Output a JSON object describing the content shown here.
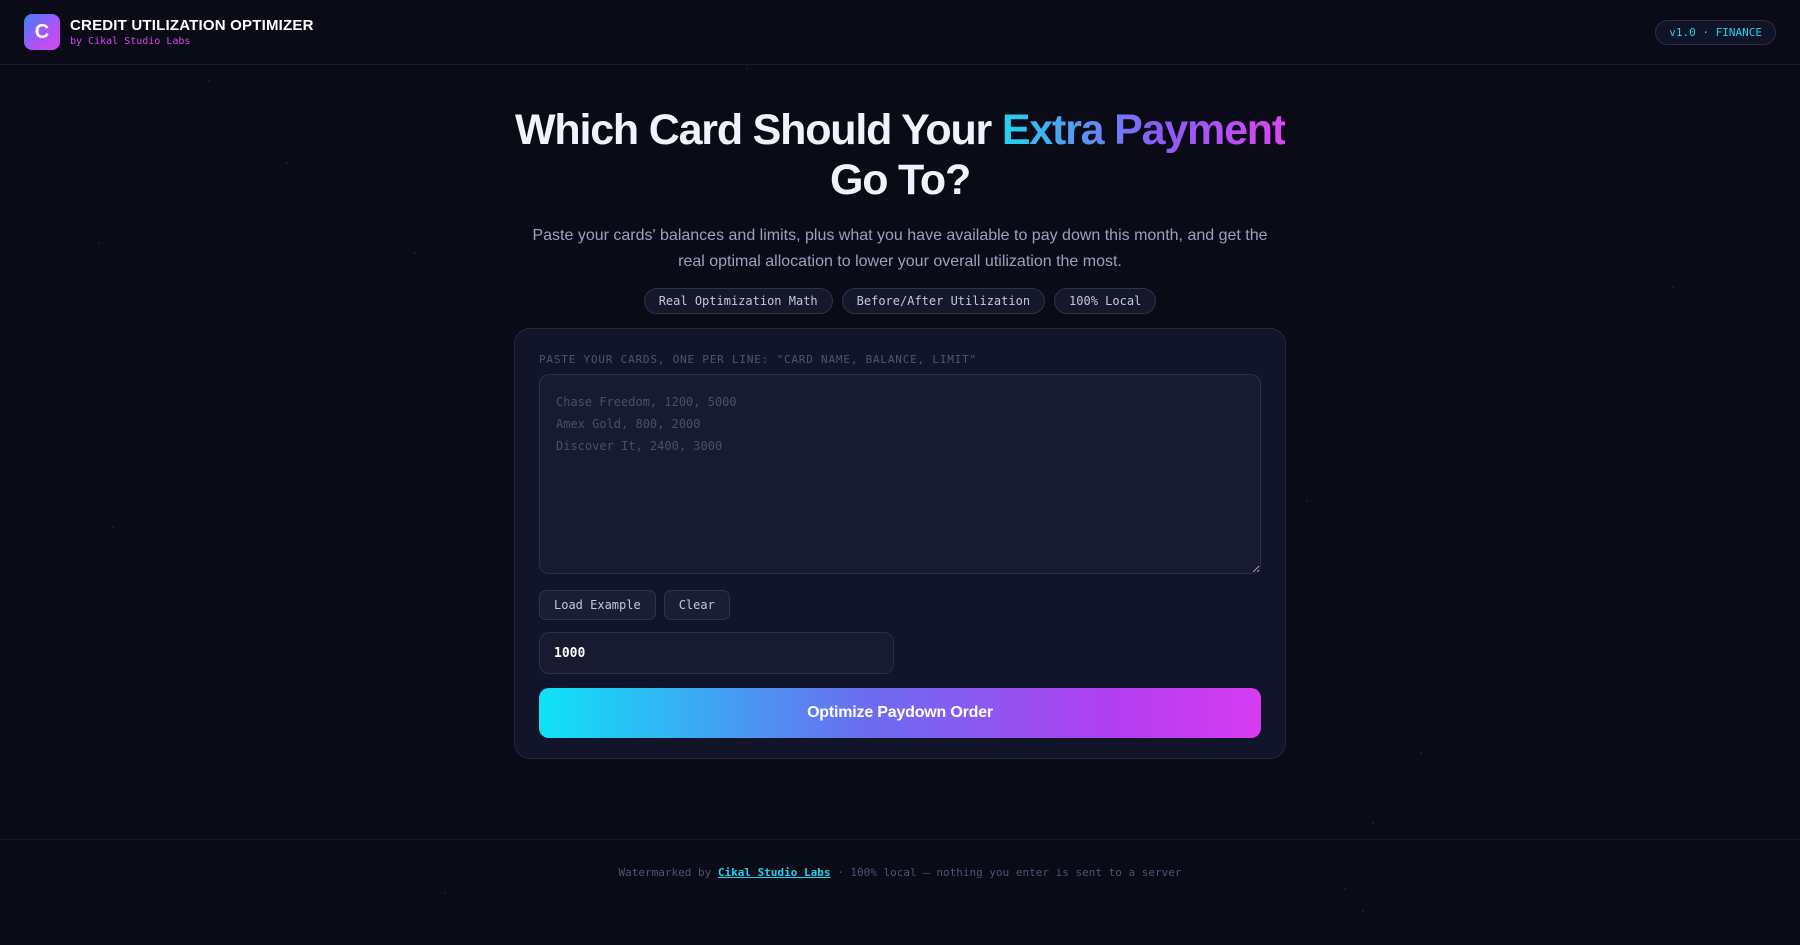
{
  "header": {
    "logo_letter": "C",
    "title": "CREDIT UTILIZATION OPTIMIZER",
    "subtitle": "by Cikal Studio Labs",
    "version_badge": "v1.0 · FINANCE"
  },
  "hero": {
    "title_line1_plain": "Which Card Should Your ",
    "title_line1_accent": "Extra Payment",
    "title_line2": "Go To?",
    "description": "Paste your cards' balances and limits, plus what you have available to pay down this month, and get the real optimal allocation to lower your overall utilization the most.",
    "chips": [
      "Real Optimization Math",
      "Before/After Utilization",
      "100% Local"
    ]
  },
  "form": {
    "cards_label": "PASTE YOUR CARDS, ONE PER LINE: \"CARD NAME, BALANCE, LIMIT\"",
    "cards_placeholder": "Chase Freedom, 1200, 5000\nAmex Gold, 800, 2000\nDiscover It, 2400, 3000",
    "cards_value": "",
    "load_example_label": "Load Example",
    "clear_label": "Clear",
    "amount_value": "1000",
    "submit_label": "Optimize Paydown Order"
  },
  "footer": {
    "prefix": "Watermarked by ",
    "link_text": "Cikal Studio Labs",
    "suffix": " · 100% local — nothing you enter is sent to a server"
  }
}
